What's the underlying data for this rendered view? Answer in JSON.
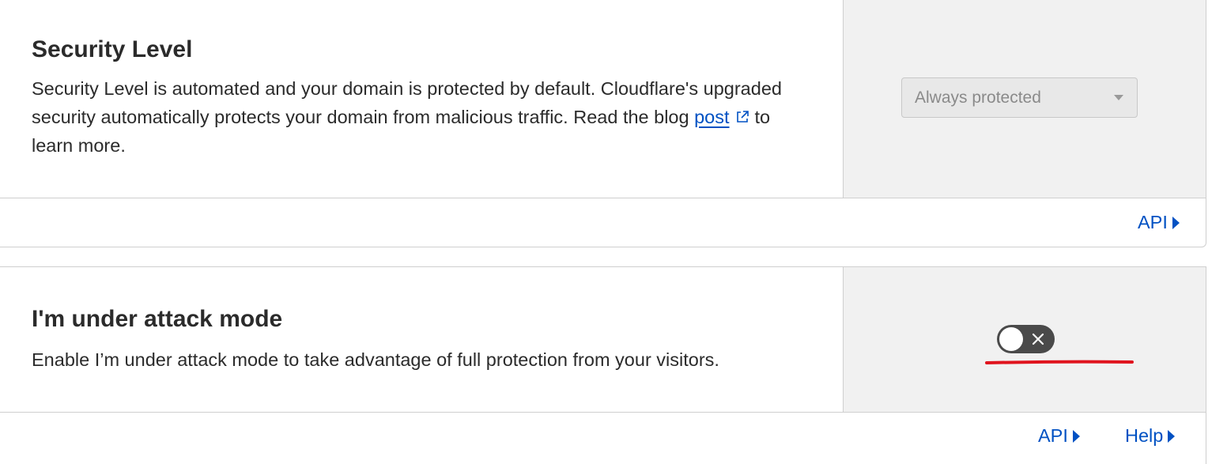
{
  "security_level": {
    "title": "Security Level",
    "desc_text": "Security Level is automated and your domain is protected by default. Cloudflare's upgraded security automatically protects your domain from malicious traffic. Read the blog",
    "link_text": "post",
    "desc_suffix": "to learn more.",
    "select_value": "Always protected",
    "api_label": "API"
  },
  "attack_mode": {
    "title": "I'm under attack mode",
    "desc": "Enable I’m under attack mode to take advantage of full protection from your visitors.",
    "toggle_state": "off",
    "api_label": "API",
    "help_label": "Help"
  },
  "colors": {
    "link": "#0051c3",
    "toggle_off": "#4a4a4a",
    "annotation": "#e0141e"
  },
  "icons": {
    "external_link": "external-link-icon",
    "dropdown": "chevron-down-icon",
    "api_arrow": "caret-right-icon",
    "toggle_x": "close-icon"
  }
}
